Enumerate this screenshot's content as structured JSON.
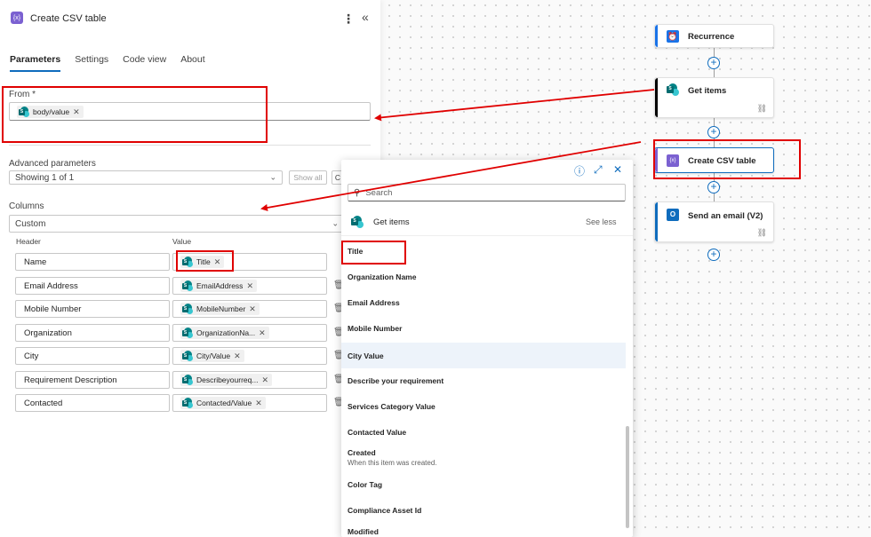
{
  "panel": {
    "title": "Create CSV table",
    "tabs": [
      "Parameters",
      "Settings",
      "Code view",
      "About"
    ],
    "from_label": "From *",
    "from_token": "body/value",
    "advanced_label": "Advanced parameters",
    "advanced_value": "Showing 1 of 1",
    "show_all": "Show all",
    "clear_partial": "C",
    "columns_label": "Columns",
    "columns_value": "Custom",
    "header_col": "Header",
    "value_col": "Value",
    "rows": [
      {
        "header": "Name",
        "value": "Title"
      },
      {
        "header": "Email Address",
        "value": "EmailAddress"
      },
      {
        "header": "Mobile Number",
        "value": "MobileNumber"
      },
      {
        "header": "Organization",
        "value": "OrganizationNa..."
      },
      {
        "header": "City",
        "value": "City/Value"
      },
      {
        "header": "Requirement Description",
        "value": "Describeyourreq..."
      },
      {
        "header": "Contacted",
        "value": "Contacted/Value"
      }
    ]
  },
  "popup": {
    "search_placeholder": "Search",
    "group_title": "Get items",
    "see_less": "See less",
    "items": [
      {
        "name": "Title",
        "desc": ""
      },
      {
        "name": "Organization Name",
        "desc": ""
      },
      {
        "name": "Email Address",
        "desc": ""
      },
      {
        "name": "Mobile Number",
        "desc": ""
      },
      {
        "name": "City Value",
        "desc": ""
      },
      {
        "name": "Describe your requirement",
        "desc": ""
      },
      {
        "name": "Services Category Value",
        "desc": ""
      },
      {
        "name": "Contacted Value",
        "desc": ""
      },
      {
        "name": "Created",
        "desc": "When this item was created."
      },
      {
        "name": "Color Tag",
        "desc": ""
      },
      {
        "name": "Compliance Asset Id",
        "desc": ""
      },
      {
        "name": "Modified",
        "desc": ""
      }
    ]
  },
  "flow": {
    "nodes": [
      {
        "label": "Recurrence",
        "icon": "clock-icon",
        "accent": "#1a73e8"
      },
      {
        "label": "Get items",
        "icon": "sharepoint-icon",
        "accent": "#000000"
      },
      {
        "label": "Create CSV table",
        "icon": "data-operation-icon",
        "accent": "#7b61d1"
      },
      {
        "label": "Send an email (V2)",
        "icon": "outlook-icon",
        "accent": "#0f6cbd"
      }
    ]
  },
  "colors": {
    "brand_blue": "#0f6cbd",
    "annotation_red": "#e00000",
    "data_op_purple": "#7b61d1",
    "sharepoint_teal": "#038387"
  }
}
